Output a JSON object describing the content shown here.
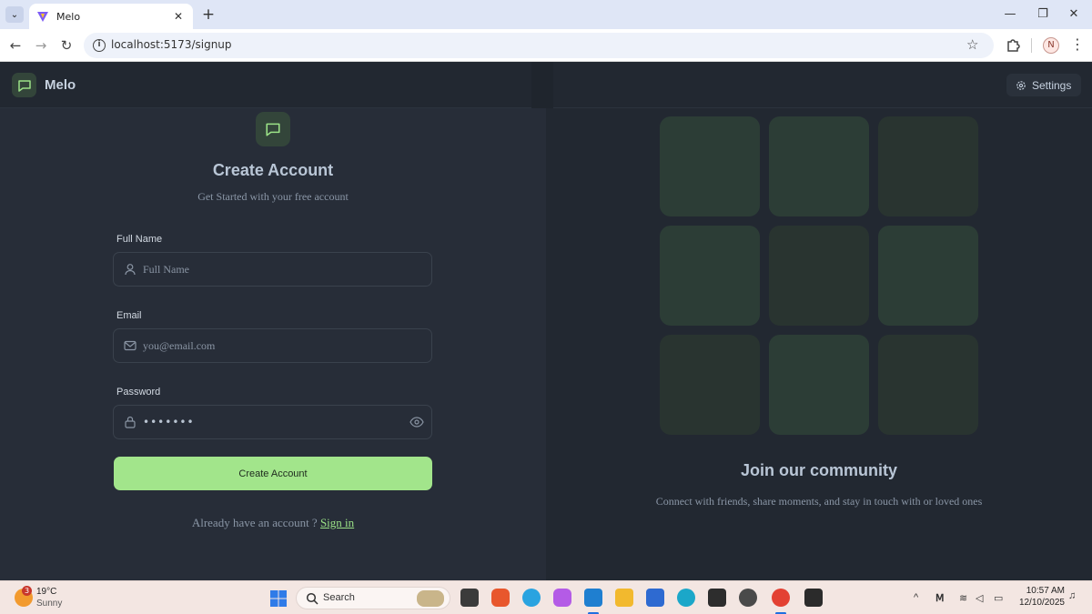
{
  "browser": {
    "tab_title": "Melo",
    "url": "localhost:5173/signup",
    "profile_initial": "N"
  },
  "app": {
    "brand": "Melo",
    "settings_label": "Settings",
    "accent_color": "#a2e58b"
  },
  "form": {
    "title": "Create Account",
    "subtitle": "Get Started with your free account",
    "full_name_label": "Full Name",
    "full_name_placeholder": "Full Name",
    "email_label": "Email",
    "email_placeholder": "you@email.com",
    "password_label": "Password",
    "password_value": "•••••••",
    "submit_label": "Create Account",
    "signin_prompt": "Already have an account ?",
    "signin_link": "Sign in"
  },
  "community": {
    "title": "Join our community",
    "subtitle": "Connect with friends, share moments, and stay in touch with or loved ones"
  },
  "taskbar": {
    "temp": "19°C",
    "weather": "Sunny",
    "weather_badge": "3",
    "search_label": "Search",
    "time": "10:57 AM",
    "date": "12/10/2025"
  }
}
